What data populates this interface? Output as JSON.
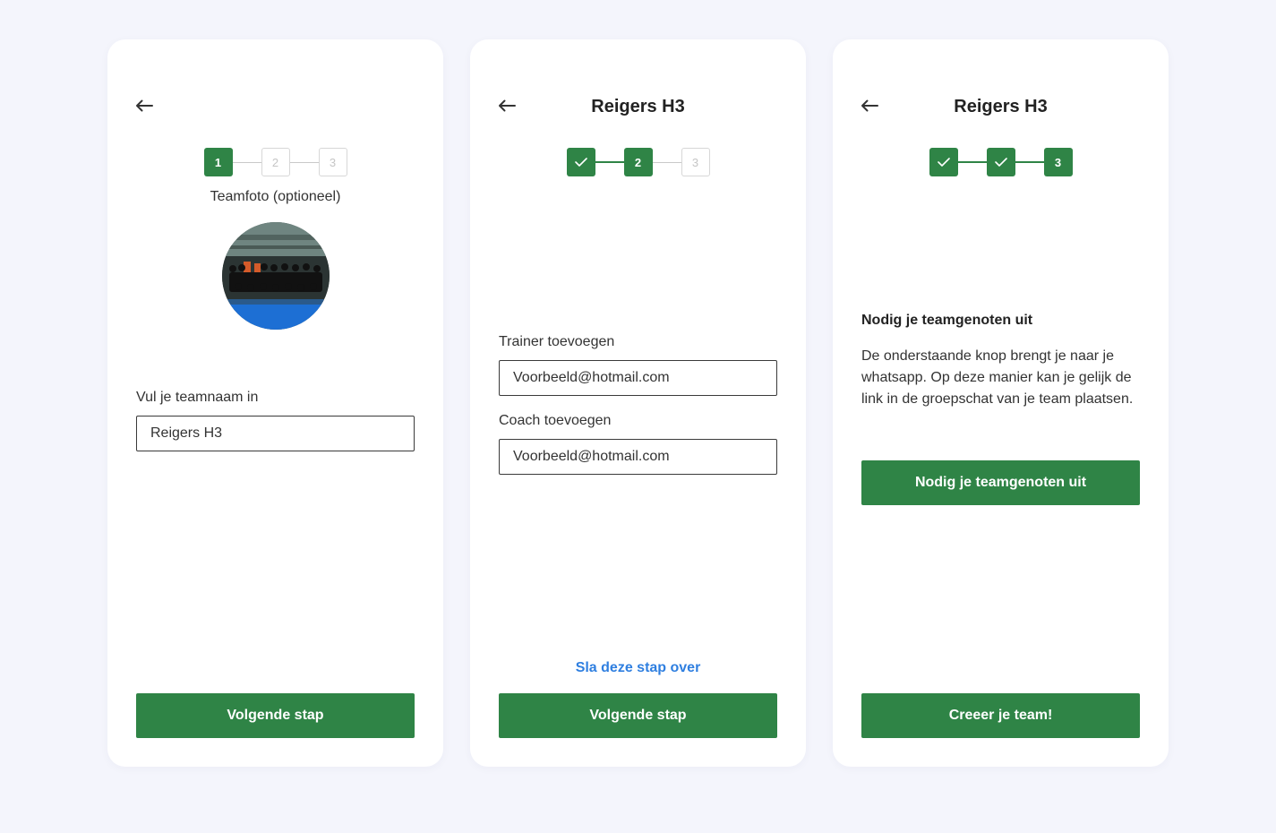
{
  "screen1": {
    "steps": [
      "1",
      "2",
      "3"
    ],
    "photo_label": "Teamfoto (optioneel)",
    "name_label": "Vul je teamnaam in",
    "name_value": "Reigers H3",
    "next_button": "Volgende stap"
  },
  "screen2": {
    "title": "Reigers H3",
    "steps": [
      "",
      "2",
      "3"
    ],
    "trainer_label": "Trainer toevoegen",
    "trainer_value": "Voorbeeld@hotmail.com",
    "coach_label": "Coach toevoegen",
    "coach_value": "Voorbeeld@hotmail.com",
    "skip_link": "Sla deze stap over",
    "next_button": "Volgende stap"
  },
  "screen3": {
    "title": "Reigers H3",
    "steps": [
      "",
      "",
      "3"
    ],
    "heading": "Nodig je teamgenoten uit",
    "description": "De onderstaande knop brengt je naar je whatsapp. Op deze manier kan je gelijk de link in de groepschat van je team plaatsen.",
    "invite_button": "Nodig je teamgenoten uit",
    "create_button": "Creeer je team!"
  },
  "colors": {
    "primary": "#2f8446",
    "link": "#2f7fe0",
    "background": "#f4f5fc"
  },
  "icons": {
    "back": "arrow-left-icon",
    "done": "check-icon"
  }
}
